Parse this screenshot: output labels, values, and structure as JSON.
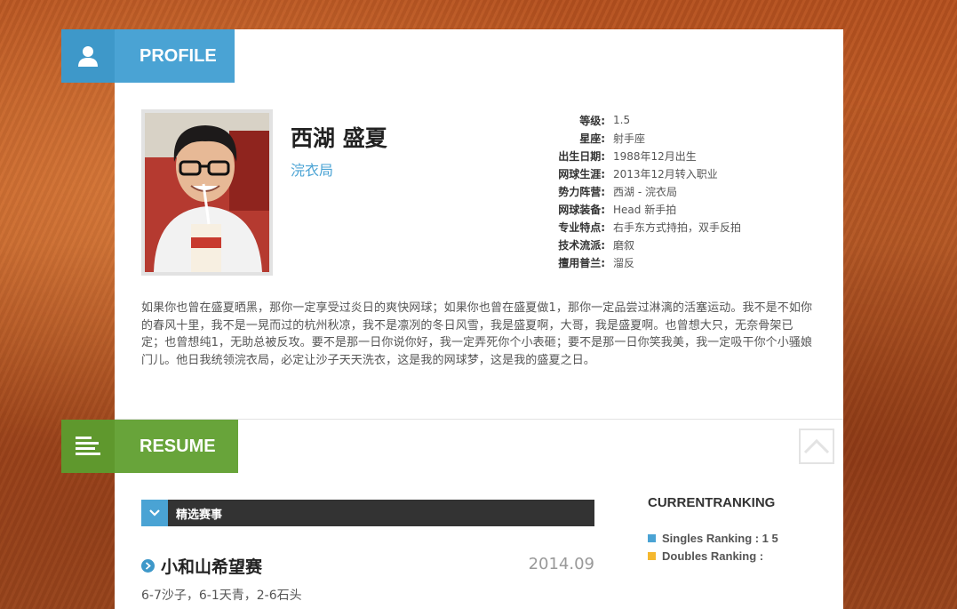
{
  "profile": {
    "header_label": "PROFILE",
    "name": "西湖 盛夏",
    "team": "浣衣局",
    "info": [
      {
        "key": "等级:",
        "value": "1.5"
      },
      {
        "key": "星座:",
        "value": "射手座"
      },
      {
        "key": "出生日期:",
        "value": "1988年12月出生"
      },
      {
        "key": "网球生涯:",
        "value": "2013年12月转入职业"
      },
      {
        "key": "势力阵营:",
        "value": "西湖 - 浣衣局"
      },
      {
        "key": "网球装备:",
        "value": "Head 新手拍"
      },
      {
        "key": "专业特点:",
        "value": "右手东方式持拍，双手反拍"
      },
      {
        "key": "技术流派:",
        "value": "磨叙"
      },
      {
        "key": "擅用普兰:",
        "value": "溜反"
      }
    ],
    "bio": "如果你也曾在盛夏晒黑，那你一定享受过炎日的爽快网球；如果你也曾在盛夏做1，那你一定品尝过淋漓的活塞运动。我不是不如你的春风十里，我不是一晃而过的杭州秋凉，我不是凛冽的冬日风雪，我是盛夏啊，大哥，我是盛夏啊。也曾想大只，无奈骨架已定；也曾想纯1，无助总被反攻。要不是那一日你说你好，我一定弄死你个小表砸；要不是那一日你笑我美，我一定吸干你个小骚娘门儿。他日我统领浣衣局，必定让沙子天天洗衣，这是我的网球梦，这是我的盛夏之日。"
  },
  "resume": {
    "header_label": "RESUME",
    "events_label": "精选赛事",
    "event": {
      "title": "小和山希望赛",
      "date": "2014.09",
      "score": "6-7沙子，6-1天青，2-6石头"
    },
    "ranking": {
      "title": "CURRENTRANKING",
      "singles": "Singles Ranking : 1 5",
      "doubles": "Doubles Ranking :"
    }
  },
  "colors": {
    "profile_accent": "#4aa3d4",
    "resume_accent": "#68a43a",
    "singles_marker": "#4aa3d4",
    "doubles_marker": "#f5b82e"
  },
  "icons": {
    "profile": "user-icon",
    "resume": "list-icon",
    "events": "chevron-down-icon",
    "event_bullet": "chevron-right-icon",
    "back_to_top": "chevron-up-icon"
  }
}
